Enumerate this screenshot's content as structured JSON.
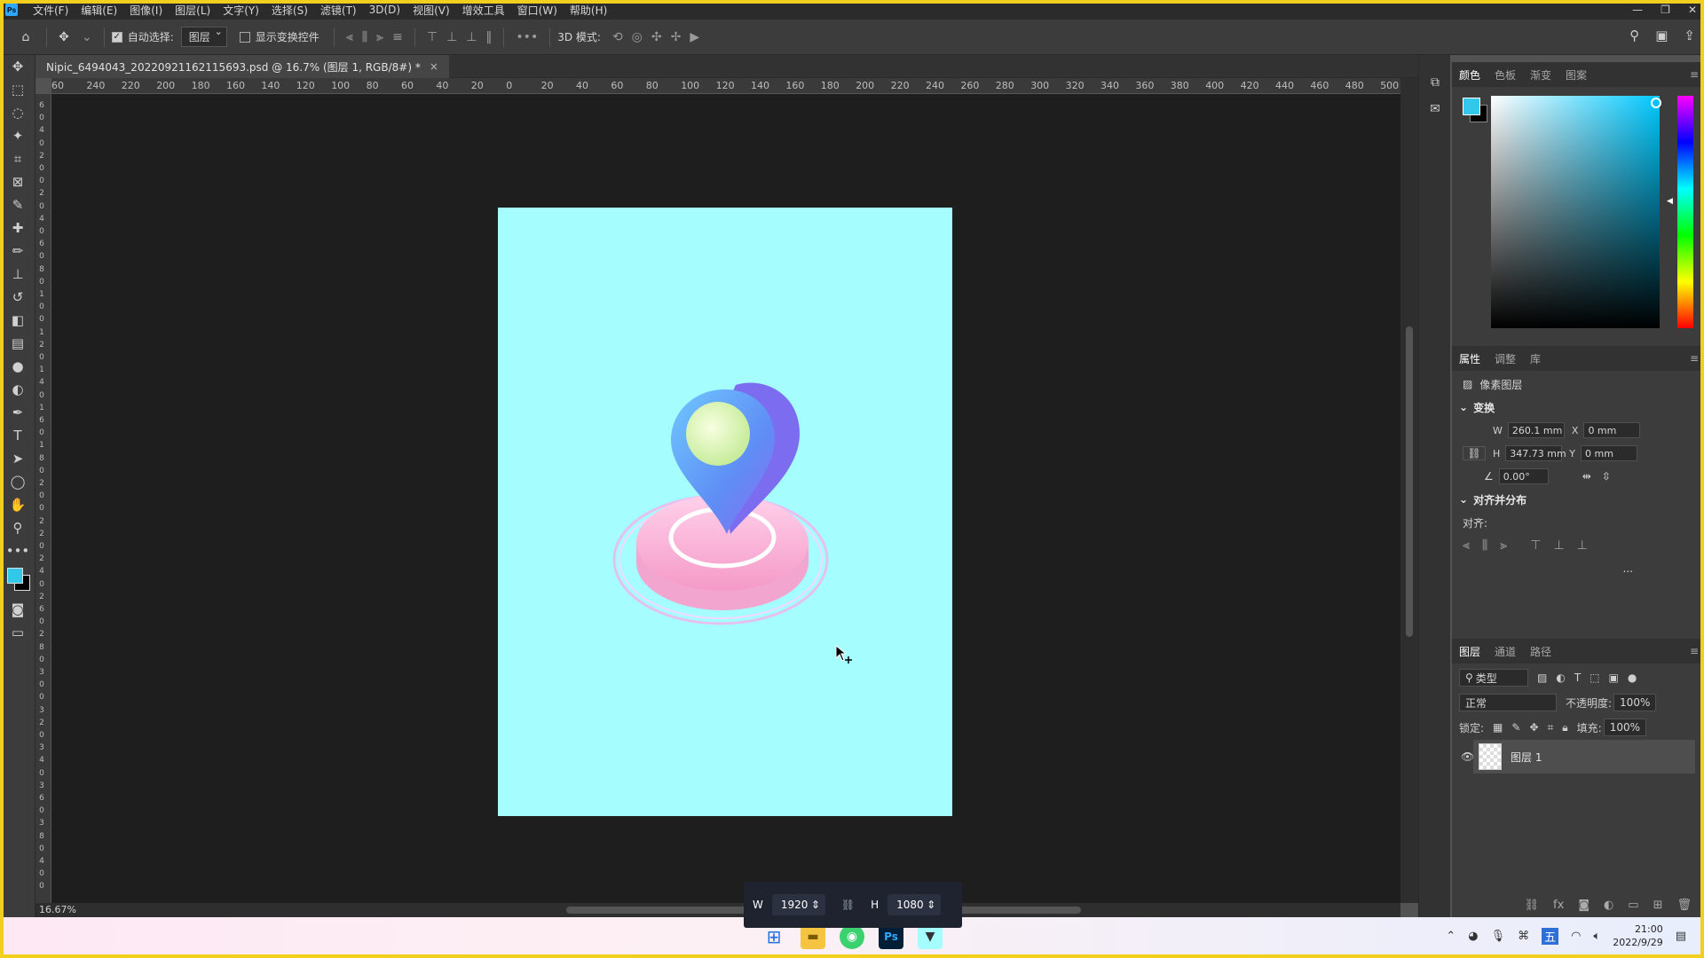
{
  "menubar": {
    "items": [
      "文件(F)",
      "编辑(E)",
      "图像(I)",
      "图层(L)",
      "文字(Y)",
      "选择(S)",
      "滤镜(T)",
      "3D(D)",
      "视图(V)",
      "增效工具",
      "窗口(W)",
      "帮助(H)"
    ]
  },
  "options": {
    "auto_select_label": "自动选择:",
    "auto_select_value": "图层",
    "show_transform_label": "显示变换控件",
    "mode_3d_label": "3D 模式:"
  },
  "document": {
    "tab_title": "Nipic_6494043_20220921162115693.psd @ 16.7% (图层 1, RGB/8#) *",
    "zoom": "16.67%",
    "artboard_color": "#a6fdfd"
  },
  "ruler": {
    "top": [
      "60",
      "240",
      "220",
      "200",
      "180",
      "160",
      "140",
      "120",
      "100",
      "80",
      "60",
      "40",
      "20",
      "0",
      "20",
      "40",
      "60",
      "80",
      "100",
      "120",
      "140",
      "160",
      "180",
      "200",
      "220",
      "240",
      "260",
      "280",
      "300",
      "320",
      "340",
      "360",
      "380",
      "400",
      "420",
      "440",
      "460",
      "480",
      "500"
    ],
    "left": [
      "6",
      "0",
      "4",
      "0",
      "2",
      "0",
      "0",
      "2",
      "0",
      "4",
      "0",
      "6",
      "0",
      "8",
      "0",
      "1",
      "0",
      "0",
      "1",
      "2",
      "0",
      "1",
      "4",
      "0",
      "1",
      "6",
      "0",
      "1",
      "8",
      "0",
      "2",
      "0",
      "0",
      "2",
      "2",
      "0",
      "2",
      "4",
      "0",
      "2",
      "6",
      "0",
      "2",
      "8",
      "0",
      "3",
      "0",
      "0",
      "3",
      "2",
      "0",
      "3",
      "4",
      "0",
      "3",
      "6",
      "0",
      "3",
      "8",
      "0",
      "4",
      "0",
      "0"
    ]
  },
  "size_hud": {
    "w_label": "W",
    "w_value": "1920",
    "h_label": "H",
    "h_value": "1080"
  },
  "color_panel": {
    "tabs": [
      "颜色",
      "色板",
      "渐变",
      "图案"
    ],
    "fg_color": "#32c8ea",
    "bg_color": "#000000"
  },
  "properties_panel": {
    "tabs": [
      "属性",
      "调整",
      "库"
    ],
    "layer_type": "像素图层",
    "transform_title": "变换",
    "w_label": "W",
    "w_value": "260.1 mm",
    "x_label": "X",
    "x_value": "0 mm",
    "h_label": "H",
    "h_value": "347.73 mm",
    "y_label": "Y",
    "y_value": "0 mm",
    "angle_value": "0.00°",
    "align_title": "对齐并分布",
    "align_label": "对齐:",
    "more": "..."
  },
  "layers_panel": {
    "tabs": [
      "图层",
      "通道",
      "路径"
    ],
    "filter_value": "类型",
    "blend_mode": "正常",
    "opacity_label": "不透明度:",
    "opacity_value": "100%",
    "lock_label": "锁定:",
    "fill_label": "填充:",
    "fill_value": "100%",
    "layer_name": "图层 1"
  },
  "taskbar": {
    "time": "21:00",
    "date": "2022/9/29",
    "ime": "五"
  }
}
